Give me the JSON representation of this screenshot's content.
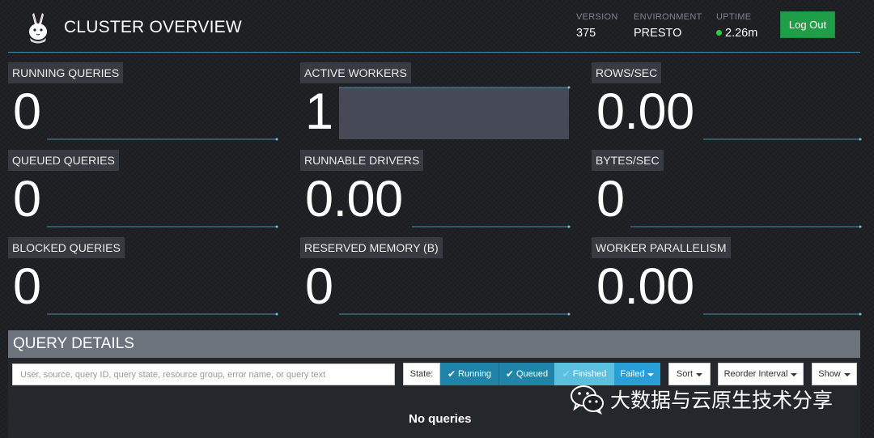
{
  "header": {
    "title": "CLUSTER OVERVIEW",
    "version_label": "VERSION",
    "version_value": "375",
    "environment_label": "ENVIRONMENT",
    "environment_value": "PRESTO",
    "uptime_label": "UPTIME",
    "uptime_value": "2.26m",
    "logout_label": "Log Out"
  },
  "metrics": [
    {
      "label": "RUNNING QUERIES",
      "value": "0"
    },
    {
      "label": "ACTIVE WORKERS",
      "value": "1"
    },
    {
      "label": "ROWS/SEC",
      "value": "0.00"
    },
    {
      "label": "QUEUED QUERIES",
      "value": "0"
    },
    {
      "label": "RUNNABLE DRIVERS",
      "value": "0.00"
    },
    {
      "label": "BYTES/SEC",
      "value": "0"
    },
    {
      "label": "BLOCKED QUERIES",
      "value": "0"
    },
    {
      "label": "RESERVED MEMORY (B)",
      "value": "0"
    },
    {
      "label": "WORKER PARALLELISM",
      "value": "0.00"
    }
  ],
  "query_details": {
    "title": "QUERY DETAILS",
    "search_placeholder": "User, source, query ID, query state, resource group, error name, or query text",
    "state_label": "State:",
    "filters": {
      "running": "Running",
      "queued": "Queued",
      "finished": "Finished",
      "failed": "Failed"
    },
    "sort_label": "Sort",
    "reorder_label": "Reorder Interval",
    "show_label": "Show",
    "empty_message": "No queries"
  },
  "watermark": {
    "text": "大数据与云原生技术分享",
    "icon": "wechat-icon"
  },
  "colors": {
    "accent_line": "#3f8fb0",
    "logout_green": "#1e9e47",
    "uptime_dot": "#2ecc40",
    "filter_active": "#1f84a8",
    "filter_finished": "#5bc0de",
    "filter_failed": "#2a9fd6"
  }
}
